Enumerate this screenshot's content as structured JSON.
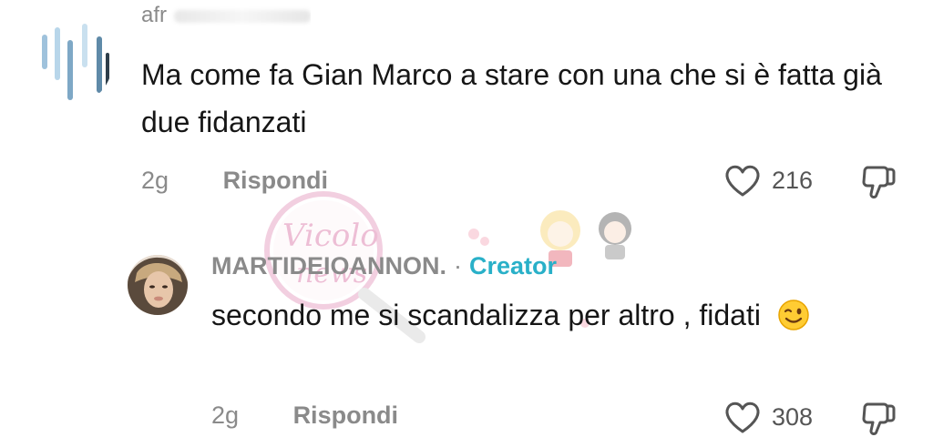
{
  "comments": [
    {
      "username": "afr",
      "text": "Ma come fa Gian Marco a stare con una che si è fatta già due fidanzati",
      "time": "2g",
      "reply_label": "Rispondi",
      "likes": "216"
    },
    {
      "username": "MARTIDEIOANNON.",
      "separator": "·",
      "badge": "Creator",
      "text": "secondo me si scandalizza per altro , fidati",
      "emoji": "😉",
      "time": "2g",
      "reply_label": "Rispondi",
      "likes": "308"
    }
  ],
  "watermark": {
    "text": "Vicolo news"
  },
  "colors": {
    "text": "#161616",
    "muted": "#8a8a8a",
    "creator": "#29b0c8",
    "watermark": "#e9a8c8"
  },
  "icons": [
    "heart-icon",
    "thumb-down-icon",
    "wink-emoji-icon"
  ]
}
